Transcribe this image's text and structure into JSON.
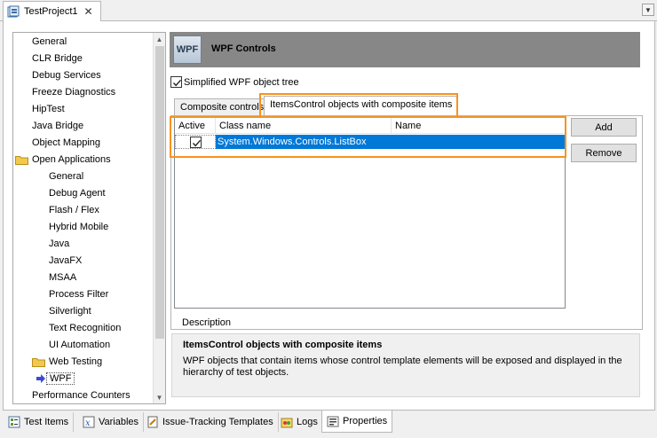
{
  "window": {
    "tab_title": "TestProject1",
    "close_glyph": "✕",
    "dropdown_glyph": "▼"
  },
  "tree": {
    "items": [
      {
        "label": "General",
        "level": 0
      },
      {
        "label": "CLR Bridge",
        "level": 0
      },
      {
        "label": "Debug Services",
        "level": 0
      },
      {
        "label": "Freeze Diagnostics",
        "level": 0
      },
      {
        "label": "HipTest",
        "level": 0
      },
      {
        "label": "Java Bridge",
        "level": 0
      },
      {
        "label": "Object Mapping",
        "level": 0
      },
      {
        "label": "Open Applications",
        "level": 0,
        "folder": true
      },
      {
        "label": "General",
        "level": 1
      },
      {
        "label": "Debug Agent",
        "level": 1
      },
      {
        "label": "Flash / Flex",
        "level": 1
      },
      {
        "label": "Hybrid Mobile",
        "level": 1
      },
      {
        "label": "Java",
        "level": 1
      },
      {
        "label": "JavaFX",
        "level": 1
      },
      {
        "label": "MSAA",
        "level": 1
      },
      {
        "label": "Process Filter",
        "level": 1
      },
      {
        "label": "Silverlight",
        "level": 1
      },
      {
        "label": "Text Recognition",
        "level": 1
      },
      {
        "label": "UI Automation",
        "level": 1
      },
      {
        "label": "Web Testing",
        "level": 1,
        "folder": true
      },
      {
        "label": "WPF",
        "level": 1,
        "selected": true
      },
      {
        "label": "Performance Counters",
        "level": 0
      }
    ],
    "scroll_up_glyph": "▲",
    "scroll_down_glyph": "▼"
  },
  "header": {
    "logo_text": "WPF",
    "title": "WPF Controls"
  },
  "simplified": {
    "label": "Simplified WPF object tree",
    "checked": true
  },
  "tabs": [
    {
      "label": "Composite controls",
      "active": false
    },
    {
      "label": "ItemsControl objects with composite items",
      "active": true
    }
  ],
  "grid": {
    "columns": [
      "Active",
      "Class name",
      "Name"
    ],
    "rows": [
      {
        "active": true,
        "class_name": "System.Windows.Controls.ListBox",
        "name": ""
      }
    ]
  },
  "buttons": {
    "add": "Add",
    "remove": "Remove"
  },
  "description": {
    "legend": "Description",
    "title": "ItemsControl objects with composite items",
    "text": "WPF objects that contain items whose control template elements will be exposed and displayed in the hierarchy of test objects."
  },
  "bottom_tabs": [
    {
      "label": "Test Items",
      "icon": "test-items-icon",
      "active": false
    },
    {
      "label": "Variables",
      "icon": "variables-icon",
      "active": false
    },
    {
      "label": "Issue-Tracking Templates",
      "icon": "issue-tracking-icon",
      "active": false
    },
    {
      "label": "Logs",
      "icon": "logs-icon",
      "active": false
    },
    {
      "label": "Properties",
      "icon": "properties-icon",
      "active": true
    }
  ],
  "colors": {
    "accent_highlight": "#f7931e",
    "selection": "#0078d7",
    "header_bar": "#878787"
  }
}
